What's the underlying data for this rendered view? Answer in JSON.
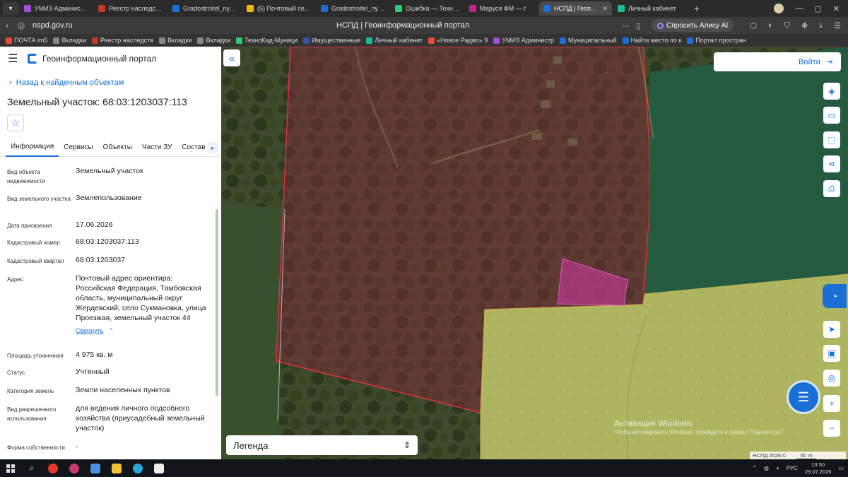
{
  "browser": {
    "tabs": [
      {
        "title": "УМИЗ Администрац",
        "color": "#a44dd6",
        "active": false
      },
      {
        "title": "Реестр наследстве",
        "color": "#c0392b",
        "active": false
      },
      {
        "title": "Gradostroitel_nye_re",
        "color": "#1a6fd6",
        "active": false
      },
      {
        "title": "(5) Почтовый серве",
        "color": "#f0b90b",
        "active": false
      },
      {
        "title": "Gradostroitel_nye_re",
        "color": "#1a6fd6",
        "active": false
      },
      {
        "title": "Ошибка — ТехноКа",
        "color": "#2ecc71",
        "active": false
      },
      {
        "title": "Маруся ФМ — г",
        "color": "#c0268a",
        "active": false
      },
      {
        "title": "НСПД | Геопорт",
        "color": "#1a6fd6",
        "active": true
      },
      {
        "title": "Личный кабинет",
        "color": "#1abc9c",
        "active": false
      }
    ],
    "url": "nspd.gov.ru",
    "page_title": "НСПД | Геоинформационный портал",
    "alice_label": "Спросить Алису AI",
    "bookmarks": [
      {
        "label": "ПОЧТА im5",
        "color": "#e74c3c"
      },
      {
        "label": "Вкладки",
        "color": "#888"
      },
      {
        "label": "Реестр наследств",
        "color": "#c0392b"
      },
      {
        "label": "Вкладки",
        "color": "#888"
      },
      {
        "label": "Вкладки",
        "color": "#888"
      },
      {
        "label": "ТехноКад-Муници",
        "color": "#2ecc71"
      },
      {
        "label": "Имущественные",
        "color": "#3455a4"
      },
      {
        "label": "Личный кабинет",
        "color": "#1abc9c"
      },
      {
        "label": "«Новое Радио» 9",
        "color": "#e74c3c"
      },
      {
        "label": "УМИЗ Администр",
        "color": "#a44dd6"
      },
      {
        "label": "Муниципальный",
        "color": "#1a6fd6"
      },
      {
        "label": "Найти место по к",
        "color": "#1a6fd6"
      },
      {
        "label": "Портал простран",
        "color": "#1a6fd6"
      }
    ]
  },
  "panel": {
    "portal_name": "Геоинформационный портал",
    "back_link": "Назад к найденным объектам",
    "object_title": "Земельный участок: 68:03:1203037:113",
    "tabs": [
      "Информация",
      "Сервисы",
      "Объекты",
      "Части ЗУ",
      "Состав"
    ],
    "attributes": [
      {
        "label": "Вид объекта недвижимости",
        "value": "Земельный участок"
      },
      {
        "label": "Вид земельного участка",
        "value": "Землепользование"
      },
      {
        "label": "Дата присвоения",
        "value": "17.06.2026"
      },
      {
        "label": "Кадастровый номер",
        "value": "68:03:1203037:113"
      },
      {
        "label": "Кадастровый квартал",
        "value": "68:03:1203037"
      },
      {
        "label": "Адрес",
        "value": "Почтовый адрес ориентира: Российская Федерация, Тамбовская область, муниципальный округ Жердевский, село Сукмановка, улица Проезжая, земельный участок 44"
      },
      {
        "label": "Площадь уточненная",
        "value": "4 975 кв. м"
      },
      {
        "label": "Статус",
        "value": "Учтенный"
      },
      {
        "label": "Категория земель",
        "value": "Земли населенных пунктов"
      },
      {
        "label": "Вид разрешенного использования",
        "value": "для ведения личного подсобного хозяйства (приусадебный земельный участок)"
      },
      {
        "label": "Форма собственности",
        "value": "-"
      }
    ],
    "collapse_link": "Свернуть"
  },
  "map": {
    "login_label": "Войти",
    "legend_label": "Легенда",
    "activation_title": "Активация Windows",
    "activation_text": "Чтобы активировать Windows, перейдите в раздел \"Параметры\".",
    "attribution": "НСПД 2026 ©",
    "scale_label": "50 m",
    "colors": {
      "parcel_highlight": "#d63aa8",
      "boundary": "#e0303a",
      "zone_yellow": "#e9e77a"
    }
  },
  "taskbar": {
    "lang": "РУС",
    "time": "13:50",
    "date": "29.07.2026"
  }
}
